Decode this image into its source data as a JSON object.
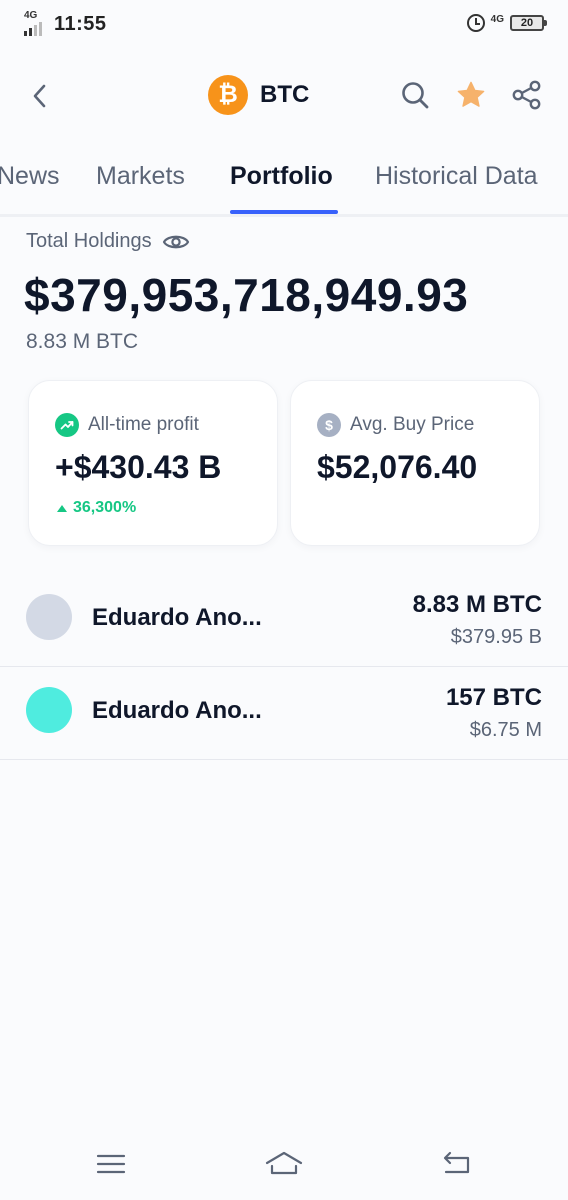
{
  "status_bar": {
    "network": "4G",
    "time": "11:55",
    "network_right": "4G",
    "battery": "20"
  },
  "header": {
    "title": "BTC",
    "coin_symbol": "₿",
    "accent_color": "#f7931a",
    "icons": [
      "back-icon",
      "search-icon",
      "star-icon",
      "share-icon"
    ]
  },
  "tabs": [
    {
      "label": "News",
      "active": false
    },
    {
      "label": "Markets",
      "active": false
    },
    {
      "label": "Portfolio",
      "active": true
    },
    {
      "label": "Historical Data",
      "active": false
    }
  ],
  "holdings": {
    "label": "Total Holdings",
    "value": "$379,953,718,949.93",
    "sub": "8.83 M BTC"
  },
  "cards": {
    "profit": {
      "label": "All-time profit",
      "value": "+$430.43 B",
      "change": "36,300%"
    },
    "avg_price": {
      "label": "Avg. Buy Price",
      "value": "$52,076.40",
      "icon_glyph": "$"
    }
  },
  "wallets": [
    {
      "name": "Eduardo Ano...",
      "amount": "8.83 M BTC",
      "value": "$379.95 B",
      "avatar_color": "#d3d9e5"
    },
    {
      "name": "Eduardo Ano...",
      "amount": "157 BTC",
      "value": "$6.75 M",
      "avatar_color": "#4fecdf"
    }
  ],
  "colors": {
    "positive": "#16c784",
    "tab_underline": "#3861fb",
    "star": "#f6b26b"
  }
}
